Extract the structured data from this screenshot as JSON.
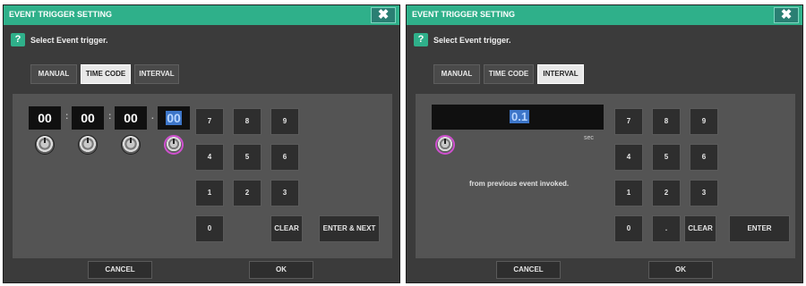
{
  "left_dialog": {
    "title": "EVENT TRIGGER SETTING",
    "close_label": "✖",
    "help_glyph": "?",
    "instruction": "Select Event trigger.",
    "tabs": [
      {
        "label": "MANUAL",
        "active": false
      },
      {
        "label": "TIME CODE",
        "active": true
      },
      {
        "label": "INTERVAL",
        "active": false
      }
    ],
    "timecode": [
      "00",
      "00",
      "00",
      "00"
    ],
    "separators": [
      ":",
      ":",
      "."
    ],
    "keypad": [
      "7",
      "8",
      "9",
      "4",
      "5",
      "6",
      "1",
      "2",
      "3",
      "0"
    ],
    "clear_label": "CLEAR",
    "enter_label": "ENTER & NEXT",
    "cancel_label": "CANCEL",
    "ok_label": "OK"
  },
  "right_dialog": {
    "title": "EVENT TRIGGER SETTING",
    "close_label": "✖",
    "help_glyph": "?",
    "instruction": "Select Event trigger.",
    "tabs": [
      {
        "label": "MANUAL",
        "active": false
      },
      {
        "label": "TIME CODE",
        "active": false
      },
      {
        "label": "INTERVAL",
        "active": true
      }
    ],
    "interval_value": "0.1",
    "unit": "sec",
    "note": "from previous event invoked.",
    "keypad": [
      "7",
      "8",
      "9",
      "4",
      "5",
      "6",
      "1",
      "2",
      "3",
      "0",
      "."
    ],
    "clear_label": "CLEAR",
    "enter_label": "ENTER",
    "cancel_label": "CANCEL",
    "ok_label": "OK"
  },
  "colors": {
    "titlebar": "#2fb08a",
    "dialog_bg": "#3b3b3b",
    "panel_bg": "#545454",
    "selection": "#3d76c9",
    "active_knob_ring": "#d050d0"
  }
}
